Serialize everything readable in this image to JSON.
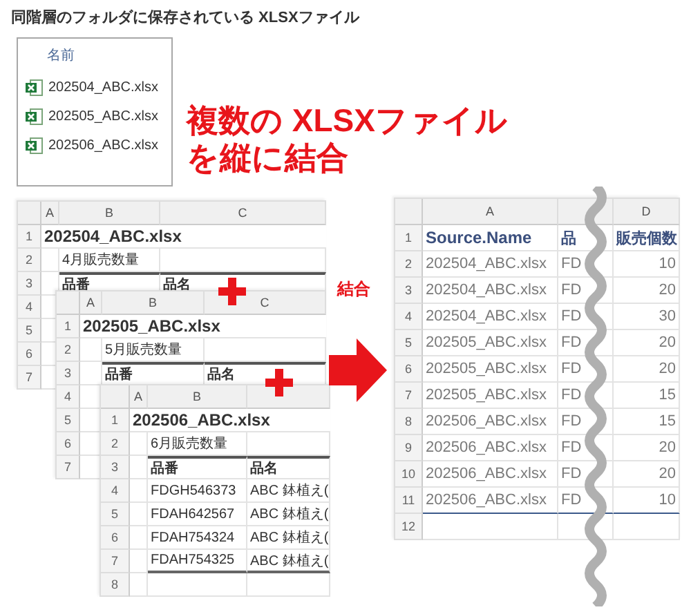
{
  "caption": "同階層のフォルダに保存されている XLSXファイル",
  "folder": {
    "header": "名前",
    "files": [
      "202504_ABC.xlsx",
      "202505_ABC.xlsx",
      "202506_ABC.xlsx"
    ]
  },
  "headline": [
    "複数の XLSXファイル",
    "を縦に結合"
  ],
  "sources": [
    {
      "columns": [
        "A",
        "B",
        "C"
      ],
      "row_numbers": [
        "1",
        "2",
        "3",
        "4",
        "5",
        "6",
        "7"
      ],
      "file_name": "202504_ABC.xlsx",
      "sheet_caption": "4月販売数量",
      "headers": [
        "品番",
        "品名"
      ]
    },
    {
      "columns": [
        "A",
        "B",
        "C"
      ],
      "row_numbers": [
        "1",
        "2",
        "3",
        "4",
        "5",
        "6",
        "7"
      ],
      "file_name": "202505_ABC.xlsx",
      "sheet_caption": "5月販売数量",
      "headers": [
        "品番",
        "品名"
      ]
    },
    {
      "columns": [
        "A",
        "B"
      ],
      "row_numbers": [
        "1",
        "2",
        "3",
        "4",
        "5",
        "6",
        "7",
        "8"
      ],
      "file_name": "202506_ABC.xlsx",
      "sheet_caption": "6月販売数量",
      "headers": [
        "品番",
        "品名"
      ],
      "rows": [
        [
          "",
          "FDGH546373",
          "ABC 鉢植え("
        ],
        [
          "",
          "FDAH642567",
          "ABC 鉢植え("
        ],
        [
          "",
          "FDAH754324",
          "ABC 鉢植え("
        ],
        [
          "",
          "FDAH754325",
          "ABC 鉢植え("
        ]
      ]
    }
  ],
  "arrow_label": "結合",
  "result": {
    "columns": [
      "A",
      "D"
    ],
    "row_numbers": [
      "1",
      "2",
      "3",
      "4",
      "5",
      "6",
      "7",
      "8",
      "9",
      "10",
      "11",
      "12"
    ],
    "headers": [
      "Source.Name",
      "品",
      "販売個数"
    ],
    "rows": [
      [
        "202504_ABC.xlsx",
        "FD",
        "10"
      ],
      [
        "202504_ABC.xlsx",
        "FD",
        "20"
      ],
      [
        "202504_ABC.xlsx",
        "FD",
        "30"
      ],
      [
        "202505_ABC.xlsx",
        "FD",
        "20"
      ],
      [
        "202505_ABC.xlsx",
        "FD",
        "20"
      ],
      [
        "202505_ABC.xlsx",
        "FD",
        "15"
      ],
      [
        "202506_ABC.xlsx",
        "FD",
        "15"
      ],
      [
        "202506_ABC.xlsx",
        "FD",
        "20"
      ],
      [
        "202506_ABC.xlsx",
        "FD",
        "20"
      ],
      [
        "202506_ABC.xlsx",
        "FD",
        "10"
      ]
    ]
  }
}
